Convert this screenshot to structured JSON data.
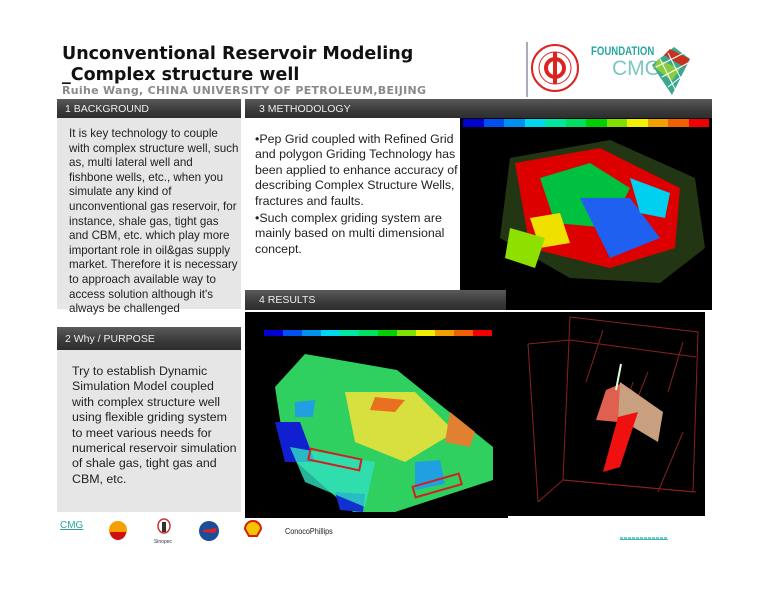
{
  "header": {
    "title_line1": "Unconventional Reservoir Modeling",
    "title_line2": "_Complex structure well",
    "author": "Ruihe Wang, CHINA  UNIVERSITY OF PETROLEUM,BEIJING",
    "logos": {
      "foundation": "FOUNDATION",
      "cmg": "CMG",
      "university_seal": "China University of Petroleum"
    }
  },
  "sections": {
    "background": {
      "heading": "1 BACKGROUND",
      "body": "It is key technology to couple with complex structure well, such as, multi lateral well and fishbone wells, etc., when you simulate any kind of unconventional gas reservoir, for instance, shale gas, tight gas and CBM, etc. which play more important role in oil&gas supply market. Therefore it is necessary to approach available way to access solution although it's always be challenged"
    },
    "purpose": {
      "heading": "2 Why / PURPOSE",
      "body": "Try to establish Dynamic Simulation Model coupled with complex structure well using flexible griding system to meet various needs for numerical reservoir simulation of shale gas, tight gas and CBM, etc."
    },
    "methodology": {
      "heading": "3 METHODOLOGY",
      "bullets": [
        "•Pep Grid coupled with Refined Grid and polygon Griding Technology has been applied to enhance accuracy of describing Complex Structure Wells, fractures and faults.",
        "•Such complex griding system are mainly based on multi dimensional concept."
      ]
    },
    "results": {
      "heading": "4 RESULTS"
    }
  },
  "colorbar": [
    "#0000d0",
    "#0050f0",
    "#0090f0",
    "#00d8f0",
    "#00e8a0",
    "#00e060",
    "#00d000",
    "#80e000",
    "#f0f000",
    "#f0a000",
    "#f06000",
    "#f00000"
  ],
  "footer": {
    "sponsors": [
      "CMG",
      "PetroChina",
      "Sinopec",
      "CNOOC",
      "Shell",
      "ConocoPhillips"
    ],
    "conoco_label": "ConocoPhillips",
    "cmg_label": "CMG"
  }
}
